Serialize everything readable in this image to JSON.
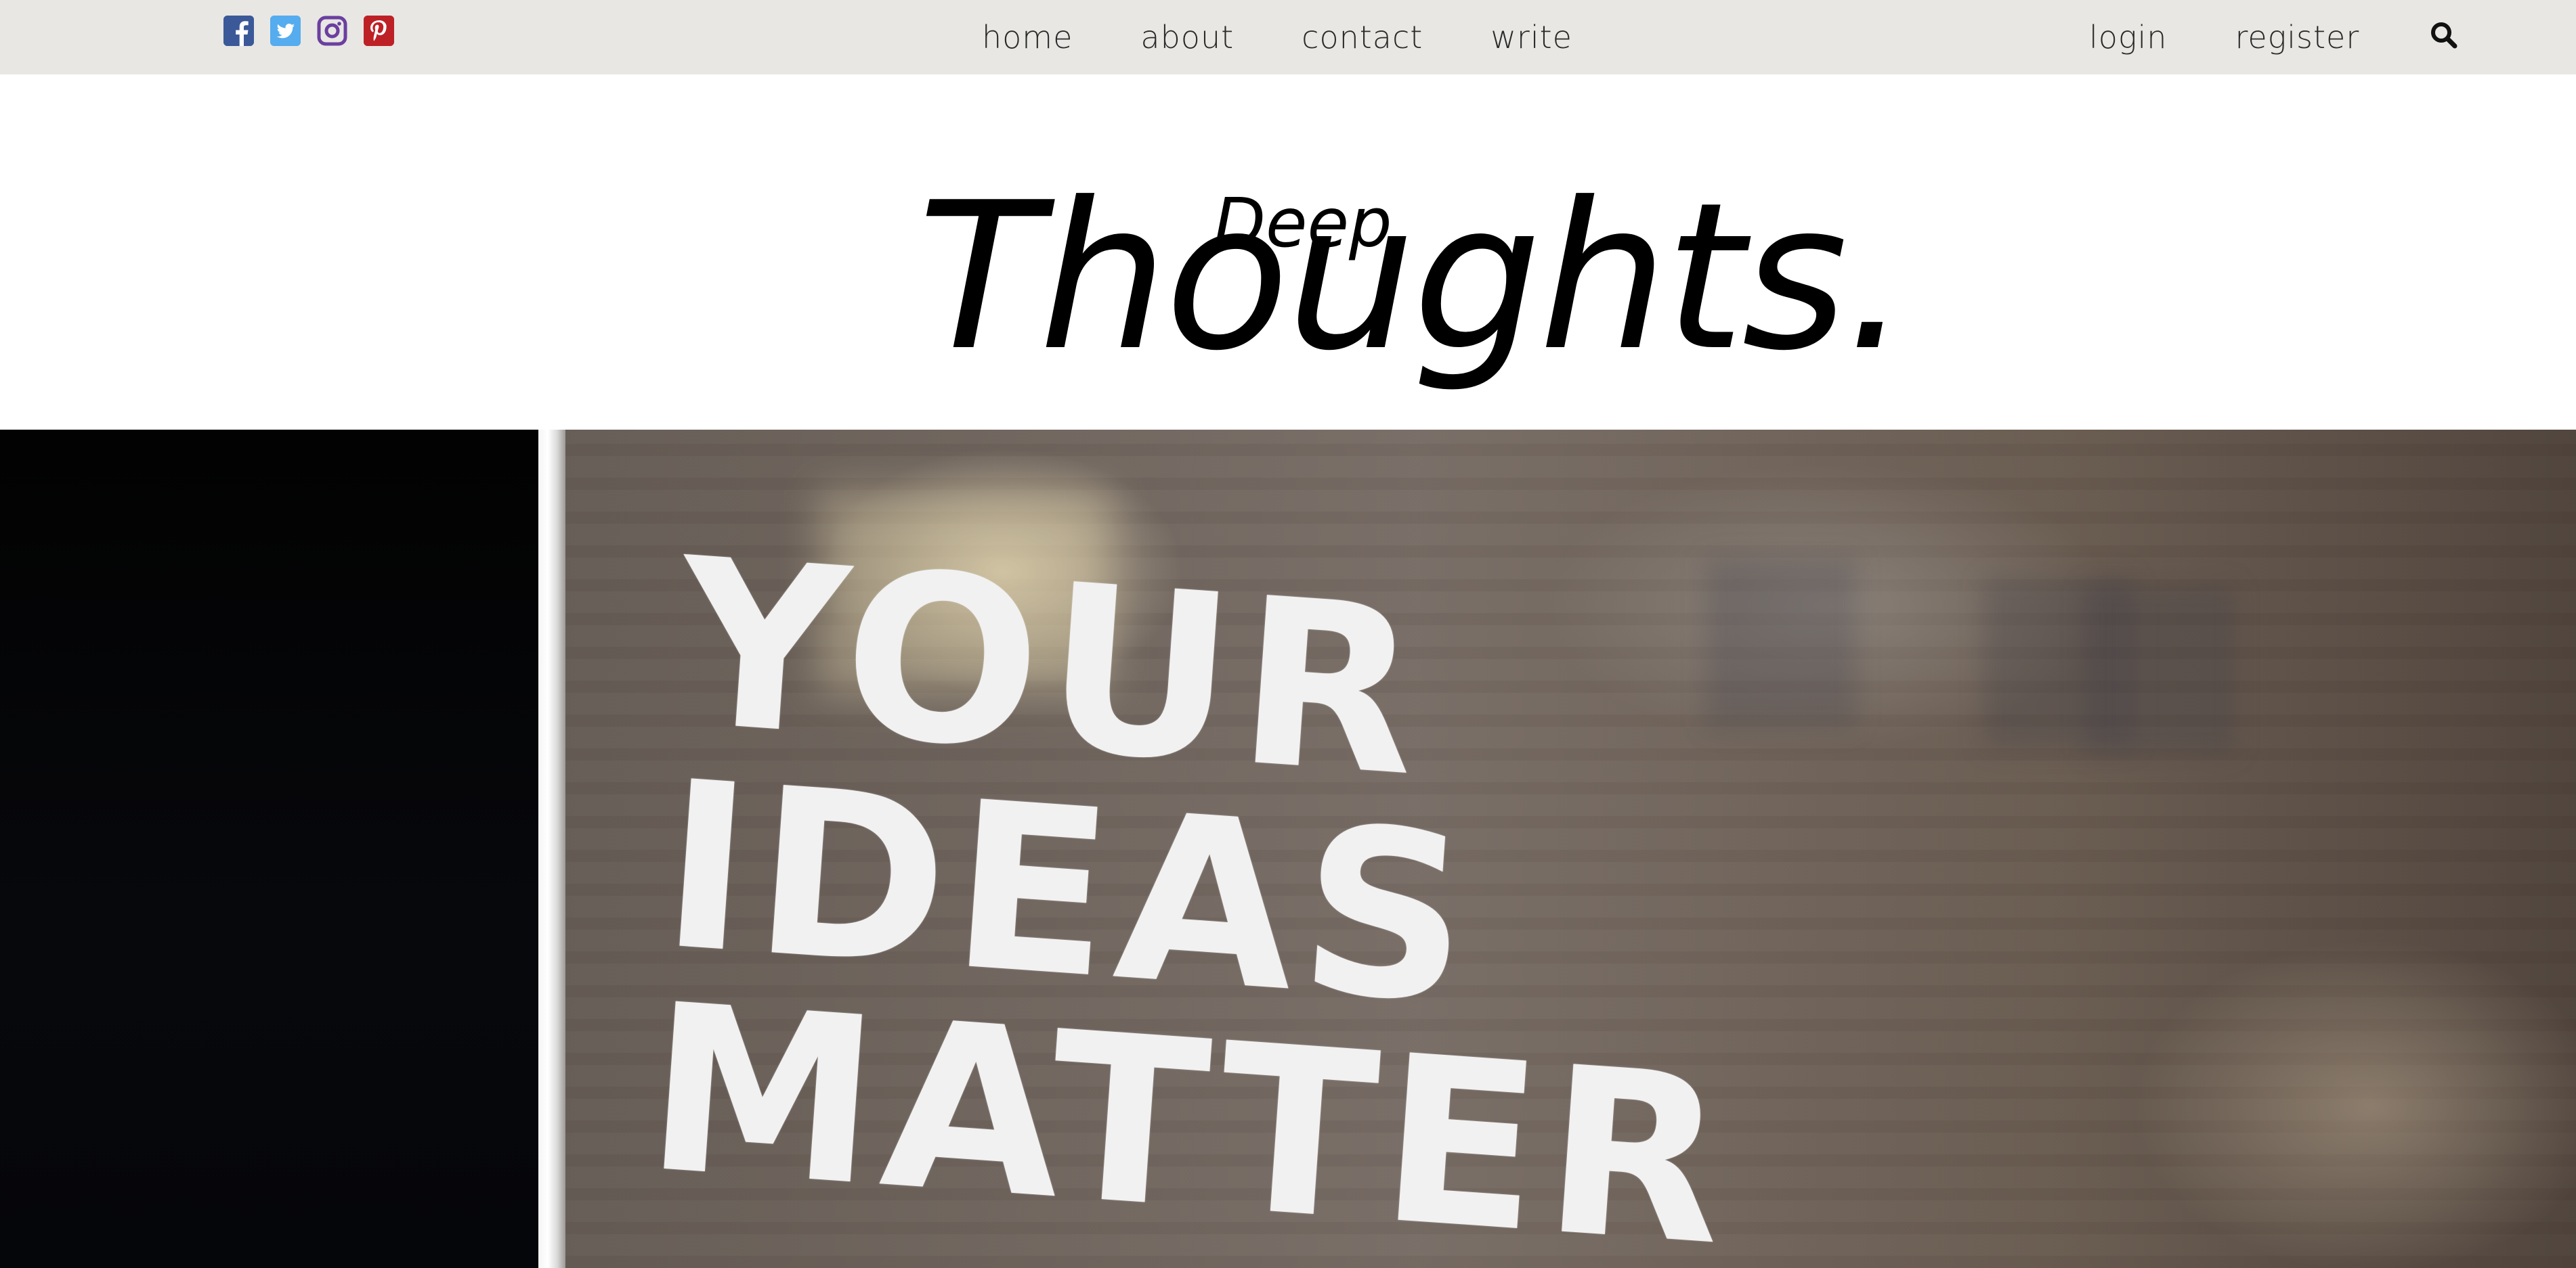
{
  "social": [
    {
      "name": "facebook-icon",
      "color": "#3b5998"
    },
    {
      "name": "twitter-icon",
      "color": "#55acee"
    },
    {
      "name": "instagram-icon",
      "color": "#6b3fa0"
    },
    {
      "name": "pinterest-icon",
      "color": "#bd2126"
    }
  ],
  "nav": {
    "center": [
      "home",
      "about",
      "contact",
      "write"
    ],
    "right": [
      "login",
      "register"
    ],
    "search_icon": "search-icon"
  },
  "logo": {
    "main": "Thoughts.",
    "sup": "Deep"
  },
  "hero": {
    "lines": [
      "YOUR",
      "IDEAS",
      "MATTER"
    ]
  },
  "colors": {
    "topbar_bg": "#e8e7e3",
    "nav_text": "#2a2a2a"
  }
}
